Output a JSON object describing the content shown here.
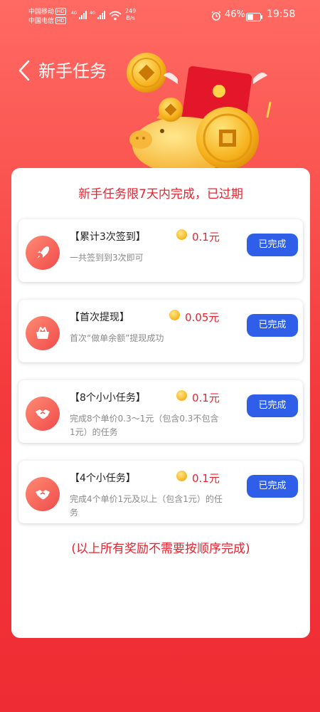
{
  "status_bar": {
    "carrier1": "中国移动",
    "carrier2": "中国电信",
    "hd": "HD",
    "net1": "4G",
    "net2": "4G",
    "speed_value": "249",
    "speed_unit": "B/s",
    "battery": "46%",
    "battery_level": 0.46,
    "time": "19:58"
  },
  "header": {
    "title": "新手任务"
  },
  "card": {
    "title": "新手任务限7天内完成，已过期",
    "footnote": "(以上所有奖励不需要按顺序完成)"
  },
  "tasks": [
    {
      "name": "【累计3次签到】",
      "reward": "0.1元",
      "desc": "一共签到到3次即可",
      "status": "已完成",
      "icon": "rocket-icon"
    },
    {
      "name": "【首次提现】",
      "reward": "0.05元",
      "desc": "首次“做单余额”提现成功",
      "status": "已完成",
      "icon": "basket-icon"
    },
    {
      "name": "【8个小小任务】",
      "reward": "0.1元",
      "desc": "完成8个单价0.3～1元（包含0.3不包含1元）的任务",
      "status": "已完成",
      "icon": "handshake-icon"
    },
    {
      "name": "【4个小任务】",
      "reward": "0.1元",
      "desc": "完成4个单价1元及以上（包含1元）的任务",
      "status": "已完成",
      "icon": "handshake-icon"
    }
  ],
  "colors": {
    "accent_red": "#e8232f",
    "button_blue": "#2f5fe9",
    "background": "#f43a3c"
  }
}
